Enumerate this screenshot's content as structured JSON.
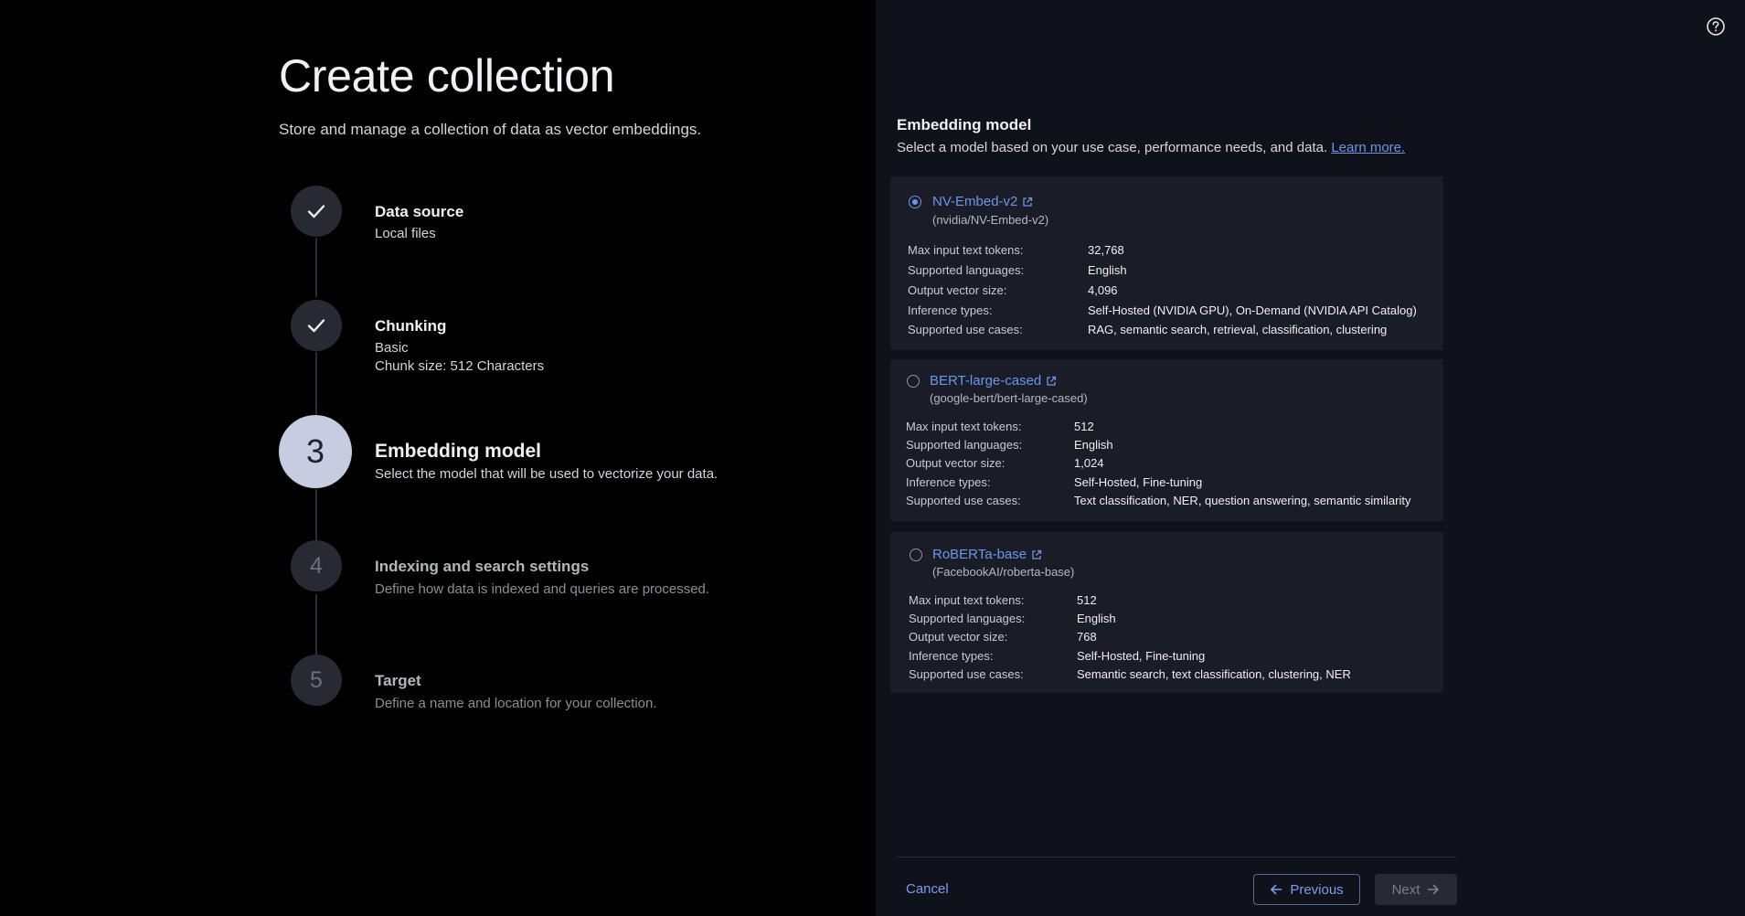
{
  "header": {
    "title": "Create collection",
    "subtitle": "Store and manage a collection of data as vector embeddings."
  },
  "steps": [
    {
      "number": "1",
      "title": "Data source",
      "desc": "Local files",
      "state": "completed"
    },
    {
      "number": "2",
      "title": "Chunking",
      "desc": "Basic",
      "desc2": "Chunk size: 512 Characters",
      "state": "completed"
    },
    {
      "number": "3",
      "title": "Embedding model",
      "desc": "Select the model that will be used to vectorize your data.",
      "state": "active"
    },
    {
      "number": "4",
      "title": "Indexing and search settings",
      "desc": "Define how data is indexed and queries are processed.",
      "state": "upcoming"
    },
    {
      "number": "5",
      "title": "Target",
      "desc": "Define a name and location for your collection.",
      "state": "upcoming"
    }
  ],
  "embedding": {
    "heading": "Embedding model",
    "description": "Select a model based on your use case, performance needs, and data.",
    "learn_more": "Learn more.",
    "spec_labels": {
      "tokens": "Max input text tokens:",
      "languages": "Supported languages:",
      "vector": "Output vector size:",
      "inference": "Inference types:",
      "use_cases": "Supported use cases:"
    },
    "models": [
      {
        "name": "NV-Embed-v2",
        "id": "(nvidia/NV-Embed-v2)",
        "selected": true,
        "tokens": "32,768",
        "languages": "English",
        "vector": "4,096",
        "inference": "Self-Hosted (NVIDIA GPU), On-Demand (NVIDIA API Catalog)",
        "use_cases": "RAG, semantic search, retrieval, classification, clustering"
      },
      {
        "name": "BERT-large-cased",
        "id": "(google-bert/bert-large-cased)",
        "selected": false,
        "tokens": "512",
        "languages": "English",
        "vector": "1,024",
        "inference": "Self-Hosted, Fine-tuning",
        "use_cases": "Text classification, NER, question answering, semantic similarity"
      },
      {
        "name": "RoBERTa-base",
        "id": "(FacebookAI/roberta-base)",
        "selected": false,
        "tokens": "512",
        "languages": "English",
        "vector": "768",
        "inference": "Self-Hosted, Fine-tuning",
        "use_cases": "Semantic search, text classification, clustering, NER"
      }
    ]
  },
  "footer": {
    "cancel": "Cancel",
    "previous": "Previous",
    "next": "Next"
  },
  "colors": {
    "accent": "#6f95e8",
    "background_left": "#010102",
    "background_right": "#10121a",
    "card": "#1a1d27"
  }
}
